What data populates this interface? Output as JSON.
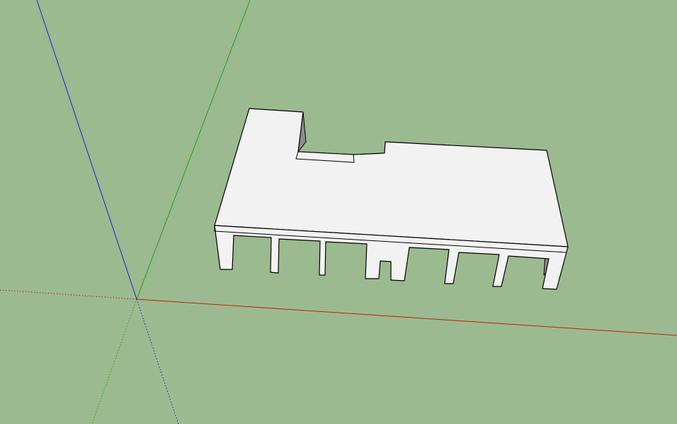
{
  "viewport": {
    "background_color": "#9bba8f"
  },
  "axes": {
    "red_axis_color": "#c0201a",
    "green_axis_color": "#1fa01f",
    "blue_axis_color": "#1f1fc8"
  },
  "model": {
    "face_color": "#f2f2f2",
    "shadow_color": "#8c8c8c",
    "edge_color": "#000000"
  }
}
